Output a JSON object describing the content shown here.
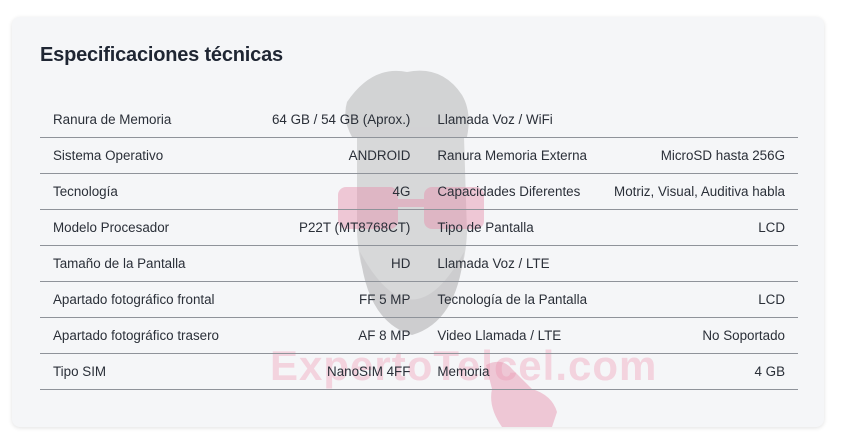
{
  "section": {
    "title": "Especificaciones técnicas"
  },
  "specs": {
    "rows": [
      {
        "left_label": "Ranura de Memoria",
        "left_value": "64 GB / 54 GB (Aprox.)",
        "right_label": "Llamada Voz / WiFi",
        "right_value": ""
      },
      {
        "left_label": "Sistema Operativo",
        "left_value": "ANDROID",
        "right_label": "Ranura Memoria Externa",
        "right_value": "MicroSD hasta 256G"
      },
      {
        "left_label": "Tecnología",
        "left_value": "4G",
        "right_label": "Capacidades Diferentes",
        "right_value": "Motriz, Visual, Auditiva habla"
      },
      {
        "left_label": "Modelo Procesador",
        "left_value": "P22T (MT8768CT)",
        "right_label": "Tipo de Pantalla",
        "right_value": "LCD"
      },
      {
        "left_label": "Tamaño de la Pantalla",
        "left_value": "HD",
        "right_label": "Llamada Voz / LTE",
        "right_value": ""
      },
      {
        "left_label": "Apartado fotográfico frontal",
        "left_value": "FF 5 MP",
        "right_label": "Tecnología de la Pantalla",
        "right_value": "LCD"
      },
      {
        "left_label": "Apartado fotográfico trasero",
        "left_value": "AF 8 MP",
        "right_label": "Video Llamada / LTE",
        "right_value": "No Soportado"
      },
      {
        "left_label": "Tipo SIM",
        "left_value": "NanoSIM 4FF",
        "right_label": "Memoria",
        "right_value": "4 GB"
      }
    ]
  },
  "watermark": {
    "text": "ExpertoTelcel.com",
    "icon": "hipster-face-with-pointing-hand-icon"
  },
  "colors": {
    "card_background": "#f5f6f8",
    "text": "#2a2f38",
    "divider": "#8f939a",
    "watermark_pink": "#e8a3b8"
  }
}
